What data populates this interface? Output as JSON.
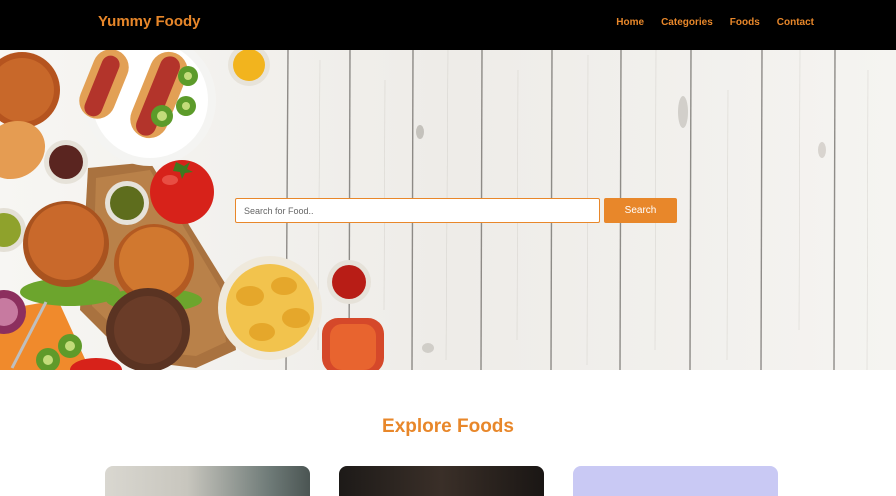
{
  "navbar": {
    "brand": "Yummy Foody",
    "links": [
      "Home",
      "Categories",
      "Foods",
      "Contact"
    ]
  },
  "hero": {
    "search_placeholder": "Search for Food..",
    "search_button": "Search"
  },
  "explore": {
    "title": "Explore Foods",
    "cards": [
      "food-card-1",
      "food-card-2",
      "food-card-3"
    ]
  },
  "colors": {
    "accent": "#e8872a",
    "navbar_bg": "#000000",
    "page_bg": "#ffffff"
  }
}
